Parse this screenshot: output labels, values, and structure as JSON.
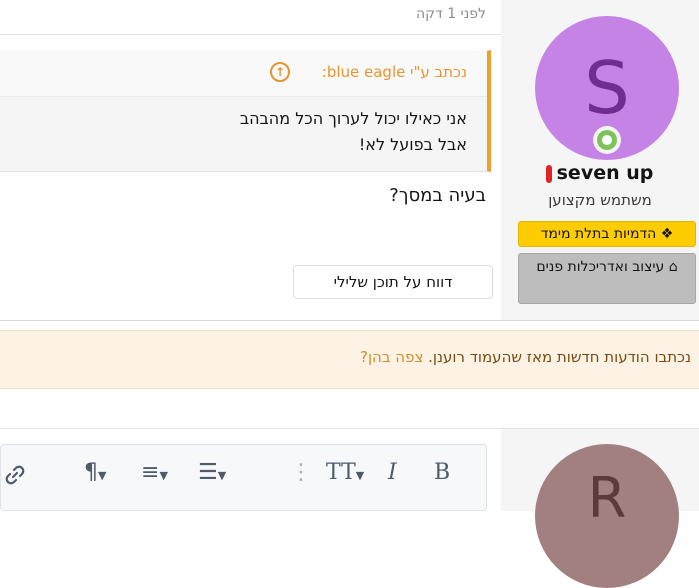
{
  "post": {
    "time": "לפני 1 דקה",
    "quote": {
      "author": "נכתב ע\"י blue eagle:",
      "lines": [
        "אני כאילו יכול לערוך הכל מהבהב",
        "אבל בפועל לא!"
      ]
    },
    "body": "בעיה במסך?",
    "report_button": "דווח על תוכן שלילי"
  },
  "user": {
    "avatar_letter": "S",
    "name": "seven up",
    "title": "משתמש מקצוען",
    "banners": [
      "הדמיות בתלת מימד",
      "עיצוב ואדריכלות פנים"
    ]
  },
  "notice": {
    "text": "נכתבו הודעות חדשות מאז שהעמוד רוענן.",
    "link": "צפה בהן?"
  },
  "reply": {
    "avatar_letter": "R",
    "toolbar": {
      "bold": "B",
      "italic": "I",
      "text_size": "TT",
      "more": "⋮",
      "list": "☰",
      "align": "≡",
      "paragraph": "¶",
      "link": "🔗"
    }
  },
  "colors": {
    "quote_accent": "#f1a02b",
    "avatar_bg": "#c583e6",
    "banner_yellow": "#fecc00",
    "online": "#7ec35a"
  }
}
